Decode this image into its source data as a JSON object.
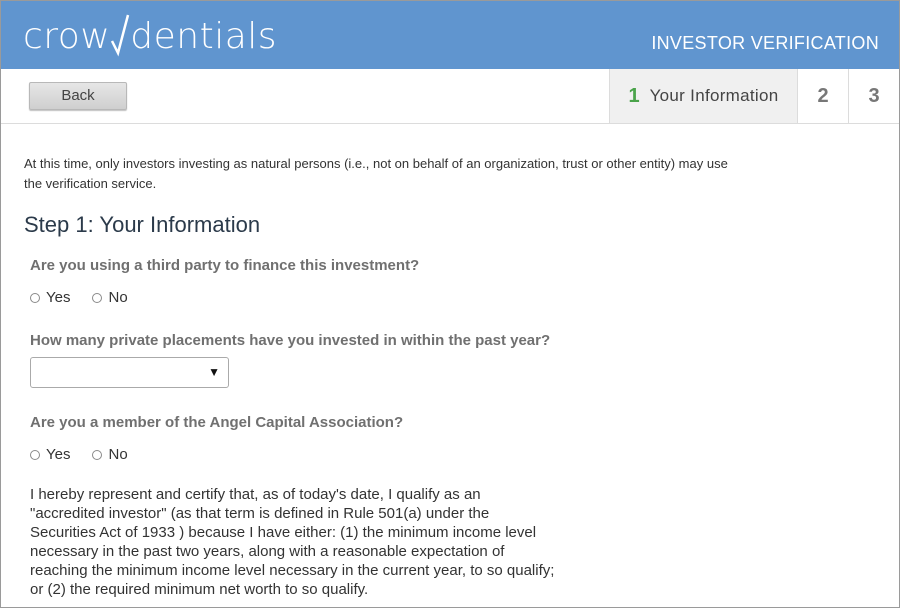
{
  "header": {
    "logo_left": "crow",
    "logo_right": "dentials",
    "portal_title": "INVESTOR VERIFICATION"
  },
  "nav": {
    "back_label": "Back",
    "steps": [
      {
        "number": "1",
        "label": "Your Information",
        "active": true
      },
      {
        "number": "2",
        "label": "",
        "active": false
      },
      {
        "number": "3",
        "label": "",
        "active": false
      }
    ]
  },
  "main": {
    "intro": "At this time, only investors investing as natural persons (i.e., not on behalf of an organization, trust or other entity) may use the verification service.",
    "step_title": "Step 1: Your Information",
    "q1": {
      "text": "Are you using a third party to finance this investment?",
      "options": [
        "Yes",
        "No"
      ]
    },
    "q2": {
      "text": "How many private placements have you invested in within the past year?",
      "selected": ""
    },
    "q3": {
      "text": "Are you a member of the Angel Capital Association?",
      "options": [
        "Yes",
        "No"
      ]
    },
    "certification": "I hereby represent and certify that, as of today's date, I qualify as an \"accredited investor\" (as that term is defined in Rule 501(a) under the Securities Act of 1933 ) because I have either: (1) the minimum income level necessary in the past two years, along with a reasonable expectation of reaching the minimum income level necessary in the current year, to so qualify; or (2) the required minimum net worth to so qualify."
  },
  "colors": {
    "header_bg": "#6095cf",
    "active_step_number": "#4aa34a",
    "step_title": "#2b3a4a"
  }
}
